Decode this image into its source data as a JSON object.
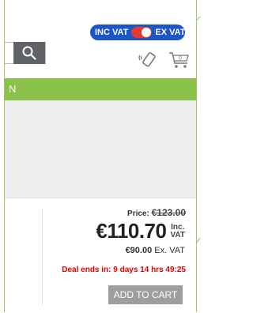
{
  "header": {
    "vat_toggle": {
      "inc_label": "INC VAT",
      "ex_label": "EX VAT"
    },
    "search": {
      "icon": "search-icon"
    },
    "icons": [
      "phone-icon",
      "cart-icon"
    ],
    "cart_count": "0"
  },
  "nav": {
    "label": "N"
  },
  "product": {
    "price_label": "Price:",
    "old_price": "€123.00",
    "price": "€110.70",
    "price_inc_suffix_1": "Inc.",
    "price_inc_suffix_2": "VAT",
    "ex_price": "€90.00",
    "ex_suffix": "Ex. VAT",
    "deal_text": "Deal ends in: 9 days 14 hrs 49:25",
    "add_to_cart_label": "ADD TO CART"
  },
  "colors": {
    "toggle_bg": "#1a56c5",
    "switch_red": "#e53935",
    "nav_green": "#8bc34a",
    "deal_red": "#e00000",
    "button_gray": "#9e9e9e"
  }
}
